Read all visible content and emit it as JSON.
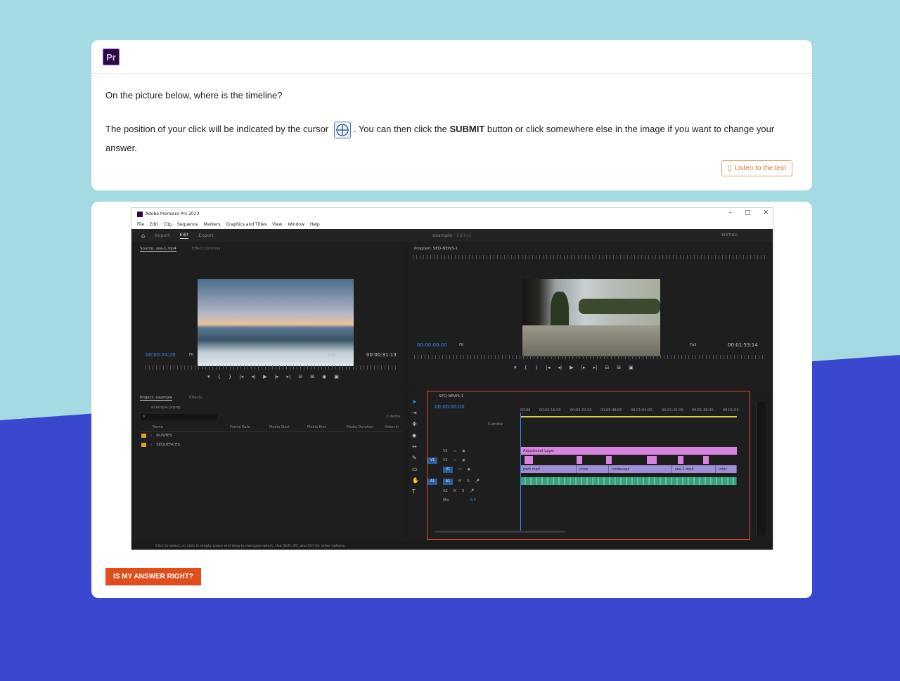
{
  "colors": {
    "bg_light": "#a6dae3",
    "bg_dark": "#3a47cf",
    "accent": "#e04e1e",
    "timeline_border": "#e34a3a"
  },
  "header": {
    "logo_text": "Pr"
  },
  "question": {
    "text": "On the picture below, where is the timeline?",
    "instr_1": "The position of your click will be indicated by the cursor",
    "instr_2": ". You can then click the",
    "instr_bold": "SUBMIT",
    "instr_3": "button or click somewhere else in the image if you want to change your answer.",
    "listen_label": "Listen to the text"
  },
  "answer_button": "IS MY ANSWER RIGHT?",
  "premiere": {
    "window_title": "Adobe Premiere Pro 2023",
    "menu": [
      "File",
      "Edit",
      "Clip",
      "Sequence",
      "Markers",
      "Graphics and Titles",
      "View",
      "Window",
      "Help"
    ],
    "workspace_tabs": [
      "Import",
      "Edit",
      "Export"
    ],
    "project_title": "example",
    "edited": "- Edited",
    "editing": "EDITING",
    "source": {
      "tab": "Source: sea-1.mp4",
      "tab2": "Effect Controls",
      "tc_left": "00:00:24:20",
      "fit": "Fit",
      "full": "Full",
      "tc_right": "00:00:31:13"
    },
    "program": {
      "tab": "Program: SEQ-NEWS-1",
      "tc_left": "00:00:00:00",
      "fit": "Fit",
      "full": "Full",
      "tc_right": "00:01:53:14"
    },
    "project": {
      "tab": "Project: example",
      "tab2": "Effects",
      "file": "example.prproj",
      "items": "2 items",
      "columns": [
        "Name",
        "Frame Rate",
        "Media Start",
        "Media End",
        "Media Duration",
        "Video In"
      ],
      "rows": [
        "RUSHES",
        "SEQUENCES"
      ]
    },
    "timeline": {
      "tab": "SEQ-NEWS-1",
      "tc": "00:00:00:00",
      "times": [
        "00:00",
        "00:00:16:00",
        "00:00:32:00",
        "00:00:48:00",
        "00:01:04:00",
        "00:01:20:00",
        "00:01:36:00",
        "00:01:52:"
      ],
      "subtitle": "Subtitle",
      "tracks": [
        "V3",
        "V2",
        "V1",
        "A1",
        "A2"
      ],
      "mix": "Mix",
      "mix_val": "0,0",
      "adjustment": "Adjustment Layer",
      "clips": [
        "park.mp4",
        "chee",
        "landscape",
        "sea-1.mp4",
        "inter"
      ]
    },
    "status": "Click to select, or click in empty space and drag to marquee select. Use Shift, Alt, and Ctrl for other options."
  }
}
